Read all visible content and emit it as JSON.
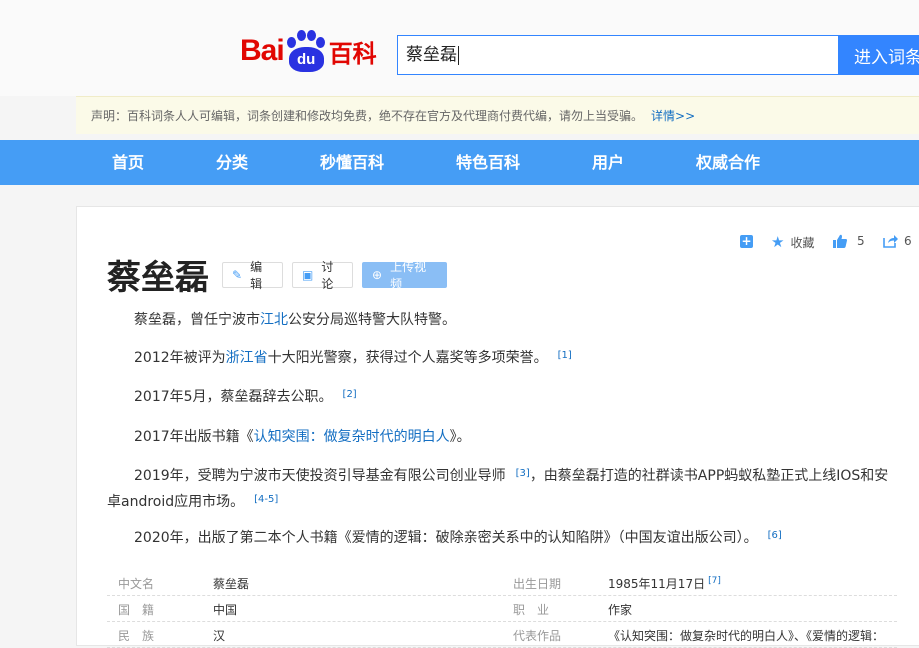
{
  "logo": {
    "part1": "Bai",
    "paw_text": "du",
    "part2": "百科"
  },
  "search": {
    "value": "蔡垒磊",
    "button_label": "进入词条"
  },
  "notice": {
    "text": "声明：百科词条人人可编辑，词条创建和修改均免费，绝不存在官方及代理商付费代编，请勿上当受骗。",
    "link": "详情>>"
  },
  "nav": [
    "首页",
    "分类",
    "秒懂百科",
    "特色百科",
    "用户",
    "权威合作"
  ],
  "tools": {
    "add_icon": "plus-square-icon",
    "favorite_label": "收藏",
    "like_count": "5",
    "share_count": "6"
  },
  "entry": {
    "title": "蔡垒磊",
    "edit_label": "编辑",
    "discuss_label": "讨论",
    "upload_label": "上传视频"
  },
  "paragraphs": {
    "p1": {
      "a": "蔡垒磊，曾任宁波市",
      "link": "江北",
      "b": "公安分局巡特警大队特警。"
    },
    "p2": {
      "a": "2012年被评为",
      "link": "浙江省",
      "b": "十大阳光警察，获得过个人嘉奖等多项荣誉。",
      "ref": "[1]"
    },
    "p3": {
      "a": "2017年5月，蔡垒磊辞去公职。",
      "ref": "[2]"
    },
    "p4": {
      "a": "2017年出版书籍《",
      "link": "认知突围：做复杂时代的明白人",
      "b": "》。"
    },
    "p5": {
      "a": "2019年，受聘为宁波市天使投资引导基金有限公司创业导师",
      "ref": "[3]",
      "b": "，由蔡垒磊打造的社群读书APP蚂蚁私塾正式上线IOS和安卓android应用市场。",
      "ref2": "[4-5]"
    },
    "p6": {
      "a": "2020年，出版了第二本个人书籍《爱情的逻辑：破除亲密关系中的认知陷阱》（中国友谊出版公司）。",
      "ref": "[6]"
    }
  },
  "info": [
    {
      "k1": "中文名",
      "v1": "蔡垒磊",
      "k2": "出生日期",
      "v2": "1985年11月17日",
      "ref2": "[7]"
    },
    {
      "k1": "国　籍",
      "v1": "中国",
      "k2": "职　业",
      "v2": "作家",
      "ref2": ""
    },
    {
      "k1": "民　族",
      "v1": "汉",
      "k2": "代表作品",
      "v2": "《认知突围：做复杂时代的明白人》、《爱情的逻辑：",
      "ref2": ""
    }
  ],
  "colors": {
    "brand_red": "#e10602",
    "brand_blue": "#2932e1",
    "nav_blue": "#459df5",
    "link": "#136ec2",
    "search_blue": "#3385ff"
  }
}
